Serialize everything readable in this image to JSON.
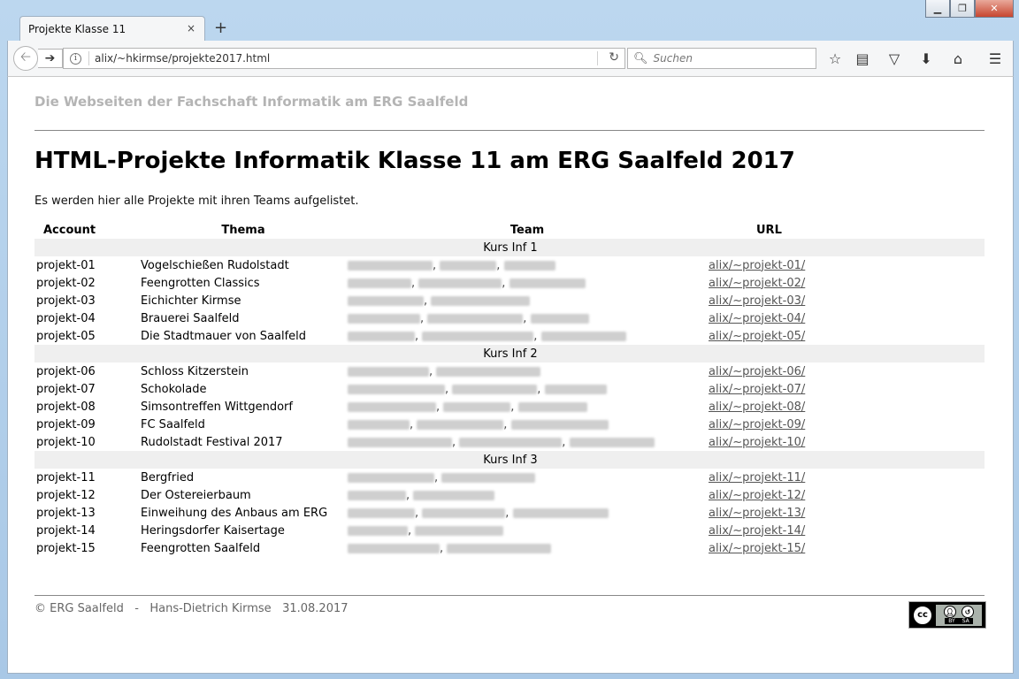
{
  "browser": {
    "tab_title": "Projekte Klasse 11",
    "tab_close": "×",
    "new_tab": "+",
    "url": "alix/~hkirmse/projekte2017.html",
    "search_placeholder": "Suchen"
  },
  "page": {
    "site_title": "Die Webseiten der Fachschaft Informatik am ERG Saalfeld",
    "heading": "HTML-Projekte Informatik Klasse 11 am ERG Saalfeld 2017",
    "intro": "Es werden hier alle Projekte mit ihren Teams aufgelistet.",
    "table": {
      "headers": [
        "Account",
        "Thema",
        "Team",
        "URL"
      ],
      "groups": [
        {
          "name": "Kurs Inf 1",
          "rows": [
            {
              "account": "projekt-01",
              "thema": "Vogelschießen Rudolstadt",
              "url": "alix/~projekt-01/"
            },
            {
              "account": "projekt-02",
              "thema": "Feengrotten Classics",
              "url": "alix/~projekt-02/"
            },
            {
              "account": "projekt-03",
              "thema": "Eichichter Kirmse",
              "url": "alix/~projekt-03/"
            },
            {
              "account": "projekt-04",
              "thema": "Brauerei Saalfeld",
              "url": "alix/~projekt-04/"
            },
            {
              "account": "projekt-05",
              "thema": "Die Stadtmauer von Saalfeld",
              "url": "alix/~projekt-05/"
            }
          ]
        },
        {
          "name": "Kurs Inf 2",
          "rows": [
            {
              "account": "projekt-06",
              "thema": "Schloss Kitzerstein",
              "url": "alix/~projekt-06/"
            },
            {
              "account": "projekt-07",
              "thema": "Schokolade",
              "url": "alix/~projekt-07/"
            },
            {
              "account": "projekt-08",
              "thema": "Simsontreffen Wittgendorf",
              "url": "alix/~projekt-08/"
            },
            {
              "account": "projekt-09",
              "thema": "FC Saalfeld",
              "url": "alix/~projekt-09/"
            },
            {
              "account": "projekt-10",
              "thema": "Rudolstadt Festival 2017",
              "url": "alix/~projekt-10/"
            }
          ]
        },
        {
          "name": "Kurs Inf 3",
          "rows": [
            {
              "account": "projekt-11",
              "thema": "Bergfried",
              "url": "alix/~projekt-11/"
            },
            {
              "account": "projekt-12",
              "thema": "Der Ostereierbaum",
              "url": "alix/~projekt-12/"
            },
            {
              "account": "projekt-13",
              "thema": "Einweihung des Anbaus am ERG",
              "url": "alix/~projekt-13/"
            },
            {
              "account": "projekt-14",
              "thema": "Heringsdorfer Kaisertage",
              "url": "alix/~projekt-14/"
            },
            {
              "account": "projekt-15",
              "thema": "Feengrotten Saalfeld",
              "url": "alix/~projekt-15/"
            }
          ]
        }
      ]
    },
    "footer": {
      "copyright": "© ERG Saalfeld",
      "separator": "-",
      "author": "Hans-Dietrich Kirmse",
      "date": "31.08.2017"
    },
    "license_badge": {
      "cc": "cc",
      "labels": [
        "BY",
        "SA"
      ]
    }
  },
  "icons": [
    "back-icon",
    "forward-icon",
    "info-icon",
    "reload-icon",
    "search-icon",
    "bookmark-star-icon",
    "reading-list-icon",
    "pocket-icon",
    "download-icon",
    "home-icon",
    "menu-icon"
  ],
  "colors": {
    "site_title": "#b4b4b4",
    "group_row_bg": "#efefef",
    "link": "#555555"
  }
}
